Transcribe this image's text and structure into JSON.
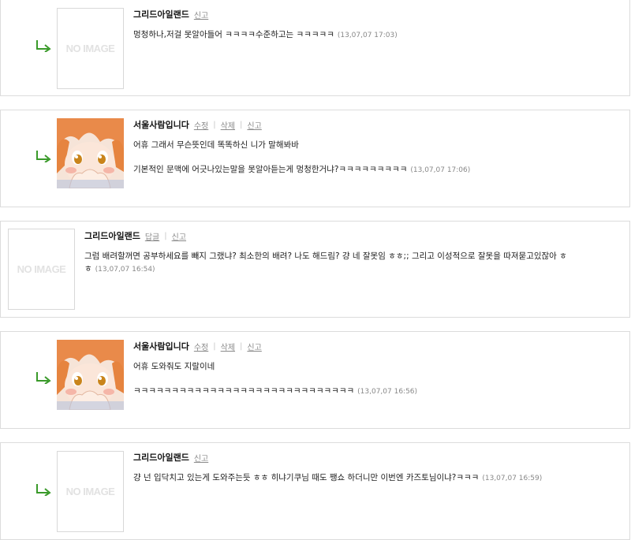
{
  "colors": {
    "arrow": "#3a9a2a",
    "border": "#dcdcdc",
    "noimage_text": "#e2e2e2"
  },
  "comments": [
    {
      "author": "그리드아일랜드",
      "actions": [
        "신고"
      ],
      "avatar": {
        "type": "noimage",
        "text": "NO IMAGE"
      },
      "lines": [
        "멍청하나,저걸 못알아들어 ㅋㅋㅋㅋ수준하고는 ㅋㅋㅋㅋㅋ"
      ],
      "time": "(13,07,07 17:03)"
    },
    {
      "author": "서울사람입니다",
      "actions": [
        "수정",
        "삭제",
        "신고"
      ],
      "avatar": {
        "type": "anime-girl"
      },
      "lines": [
        "어휴 그래서 무슨뜻인데 똑똑하신 니가 말해봐바",
        "기본적인 문맥에 어긋나있는말을 못알아듣는게 멍청한거냐?ㅋㅋㅋㅋㅋㅋㅋㅋㅋ"
      ],
      "time": "(13,07,07 17:06)"
    },
    {
      "author": "그리드아일랜드",
      "actions": [
        "답글",
        "신고"
      ],
      "avatar": {
        "type": "noimage",
        "text": "NO IMAGE"
      },
      "lines": [
        "그럼 배려할꺼면 공부하세요를 빼지 그랬냐? 최소한의 배려?  나도 해드림? 걍 네 잘못임 ㅎㅎ;; 그리고 이성적으로 잘못을 따져묻고있잖아 ㅎ",
        "ㅎ"
      ],
      "time": "(13,07,07 16:54)"
    },
    {
      "author": "서울사람입니다",
      "actions": [
        "수정",
        "삭제",
        "신고"
      ],
      "avatar": {
        "type": "anime-girl"
      },
      "lines": [
        "어휴 도와줘도 지랄이네",
        "ㅋㅋㅋㅋㅋㅋㅋㅋㅋㅋㅋㅋㅋㅋㅋㅋㅋㅋㅋㅋㅋㅋㅋㅋㅋㅋㅋㅋㅋ"
      ],
      "time": "(13,07,07 16:56)"
    },
    {
      "author": "그리드아일랜드",
      "actions": [
        "신고"
      ],
      "avatar": {
        "type": "noimage",
        "text": "NO IMAGE"
      },
      "lines": [
        "걍 넌 입닥치고 있는게 도와주는듯 ㅎㅎ 히냐기쿠님 때도 쨍쇼 하더니만 이번엔 카즈토님이냐?ㅋㅋㅋ"
      ],
      "time": "(13,07,07 16:59)"
    }
  ]
}
